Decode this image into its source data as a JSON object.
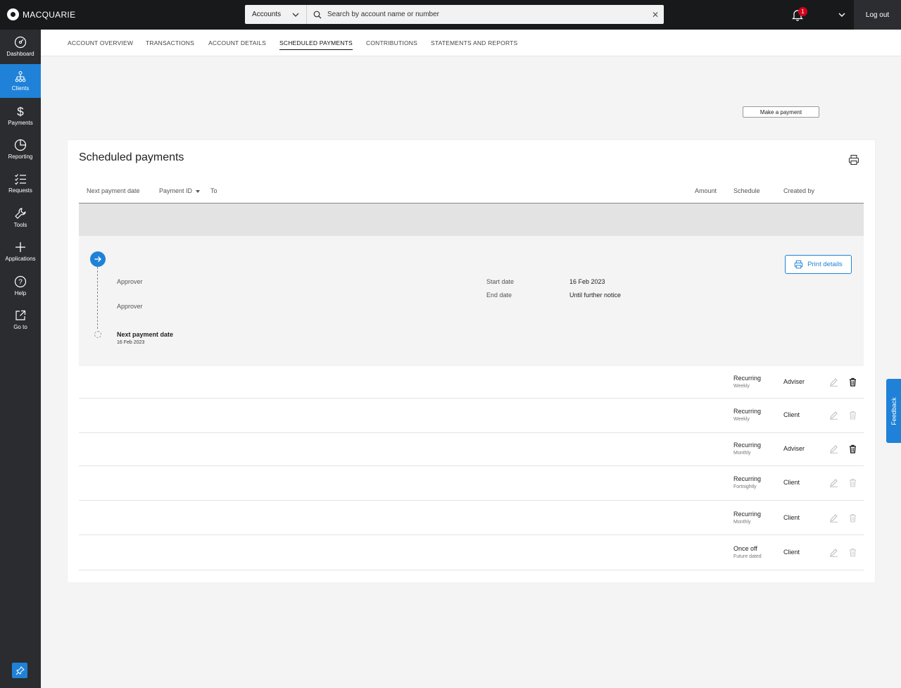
{
  "brand": {
    "name": "MACQUARIE"
  },
  "topbar": {
    "account_select": "Accounts",
    "search_placeholder": "Search by account name or number",
    "notification_count": "1",
    "logout_label": "Log out"
  },
  "sidebar": {
    "items": [
      {
        "label": "Dashboard",
        "icon": "dashboard-icon"
      },
      {
        "label": "Clients",
        "icon": "clients-icon",
        "active": true
      },
      {
        "label": "Payments",
        "icon": "dollar-icon"
      },
      {
        "label": "Reporting",
        "icon": "pie-chart-icon"
      },
      {
        "label": "Requests",
        "icon": "checklist-icon"
      },
      {
        "label": "Tools",
        "icon": "wrench-icon"
      },
      {
        "label": "Applications",
        "icon": "plus-icon"
      },
      {
        "label": "Help",
        "icon": "help-icon"
      },
      {
        "label": "Go to",
        "icon": "external-link-icon"
      }
    ]
  },
  "tabs": [
    {
      "label": "ACCOUNT OVERVIEW"
    },
    {
      "label": "TRANSACTIONS"
    },
    {
      "label": "ACCOUNT DETAILS"
    },
    {
      "label": "SCHEDULED PAYMENTS",
      "active": true
    },
    {
      "label": "CONTRIBUTIONS"
    },
    {
      "label": "STATEMENTS AND REPORTS"
    }
  ],
  "actions": {
    "make_payment": "Make a payment"
  },
  "scheduled": {
    "title": "Scheduled payments",
    "columns": {
      "next_payment_date": "Next payment date",
      "payment_id": "Payment ID",
      "to": "To",
      "amount": "Amount",
      "schedule": "Schedule",
      "created_by": "Created by"
    },
    "detail": {
      "approver_1": "Approver",
      "approver_2": "Approver",
      "next_payment_label": "Next payment date",
      "next_payment_value": "16 Feb 2023",
      "start_date_label": "Start date",
      "start_date_value": "16 Feb 2023",
      "end_date_label": "End date",
      "end_date_value": "Until further notice",
      "print_details": "Print details"
    },
    "rows": [
      {
        "schedule": "Recurring",
        "frequency": "Weekly",
        "created_by": "Adviser",
        "delete_enabled": true
      },
      {
        "schedule": "Recurring",
        "frequency": "Weekly",
        "created_by": "Client",
        "delete_enabled": false
      },
      {
        "schedule": "Recurring",
        "frequency": "Monthly",
        "created_by": "Adviser",
        "delete_enabled": true
      },
      {
        "schedule": "Recurring",
        "frequency": "Fortnightly",
        "created_by": "Client",
        "delete_enabled": false
      },
      {
        "schedule": "Recurring",
        "frequency": "Monthly",
        "created_by": "Client",
        "delete_enabled": false
      },
      {
        "schedule": "Once off",
        "frequency": "Future dated",
        "created_by": "Client",
        "delete_enabled": false
      }
    ]
  },
  "feedback": {
    "label": "Feedback"
  },
  "colors": {
    "accent": "#1f82d8",
    "sidebar": "#2b2c2f",
    "topbar": "#18191b",
    "badge": "#d0021b"
  }
}
